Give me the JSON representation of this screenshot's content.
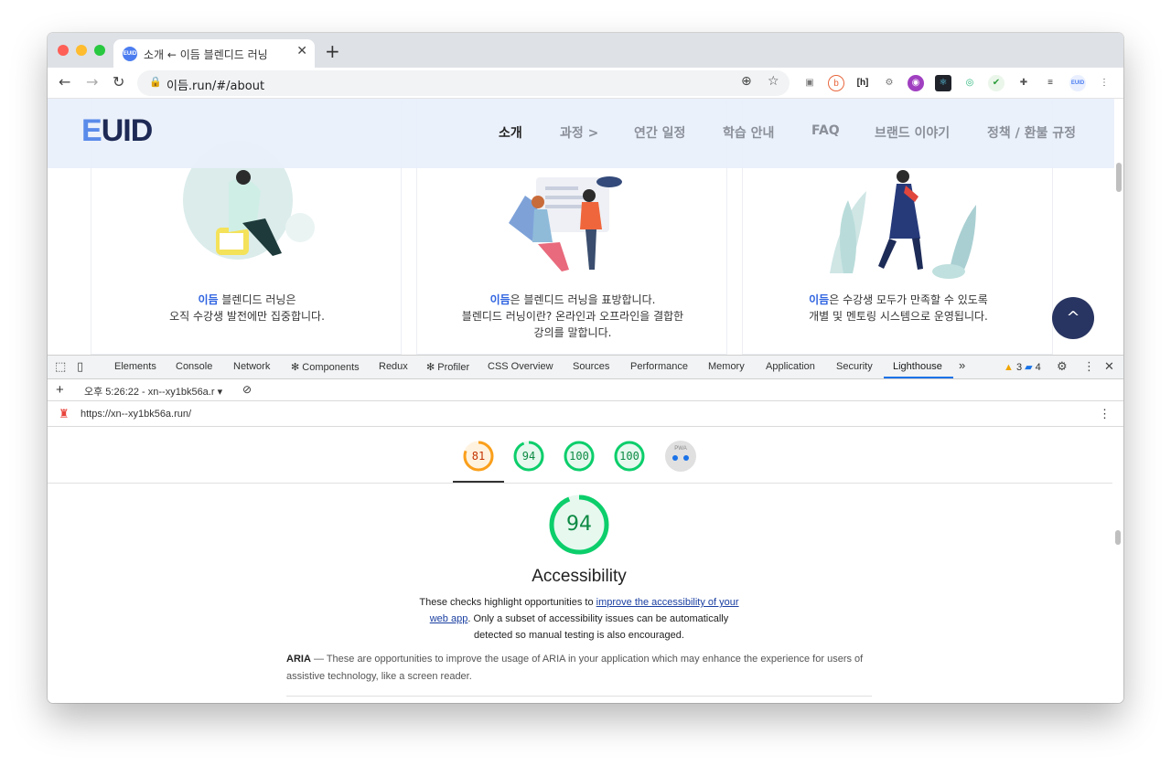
{
  "browser": {
    "tab_title": "소개 ← 이듬 블렌디드 러닝",
    "tab_favicon_text": "EUID",
    "url": "이듬.run/#/about",
    "nav": {
      "back": "←",
      "forward": "→",
      "reload": "↻",
      "new_tab": "+",
      "close": "✕"
    }
  },
  "site": {
    "logo_e": "E",
    "logo_rest": "UID",
    "nav": [
      "소개",
      "과정 >",
      "연간 일정",
      "학습 안내",
      "FAQ",
      "브랜드 이야기",
      "정책 / 환불 규정"
    ],
    "cards": [
      {
        "brand": "이듬",
        "line1_rest": " 블렌디드 러닝은",
        "line2": "오직 수강생 발전에만 집중합니다.",
        "line3": ""
      },
      {
        "brand": "이듬",
        "line1_rest": "은 블렌디드 러닝을 표방합니다.",
        "line2": "블렌디드 러닝이란? 온라인과 오프라인을 결합한",
        "line3": "강의를 말합니다."
      },
      {
        "brand": "이듬",
        "line1_rest": "은 수강생 모두가 만족할 수 있도록",
        "line2": "개별 및 멘토링 시스템으로 운영됩니다.",
        "line3": ""
      }
    ],
    "scroll_top": "^"
  },
  "devtools": {
    "tabs": [
      "Elements",
      "Console",
      "Network",
      "✻ Components",
      "Redux",
      "✻ Profiler",
      "CSS Overview",
      "Sources",
      "Performance",
      "Memory",
      "Application",
      "Security",
      "Lighthouse"
    ],
    "active_tab": "Lighthouse",
    "more": "»",
    "warnings": "3",
    "messages": "4",
    "report_selector": "오후 5:26:22 - xn--xy1bk56a.r",
    "report_url": "https://xn--xy1bk56a.run/",
    "scores": [
      {
        "value": "81",
        "color": "#fa9f1b",
        "fill": "#fff3e0",
        "fraction": 0.81
      },
      {
        "value": "94",
        "color": "#0cce6b",
        "fill": "#e7f8ef",
        "fraction": 0.94
      },
      {
        "value": "100",
        "color": "#0cce6b",
        "fill": "#e7f8ef",
        "fraction": 1.0
      },
      {
        "value": "100",
        "color": "#0cce6b",
        "fill": "#e7f8ef",
        "fraction": 1.0
      }
    ],
    "pwa_label": "PWA",
    "category": {
      "score": "94",
      "score_fraction": 0.94,
      "title": "Accessibility",
      "desc_before": "These checks highlight opportunities to ",
      "desc_link": "improve the accessibility of your web app",
      "desc_after": ". Only a subset of accessibility issues can be automatically detected so manual testing is also encouraged."
    },
    "group": {
      "title": "ARIA",
      "dash": " — ",
      "desc": "These are opportunities to improve the usage of ARIA in your application which may enhance the experience for users of assistive technology, like a screen reader."
    }
  }
}
